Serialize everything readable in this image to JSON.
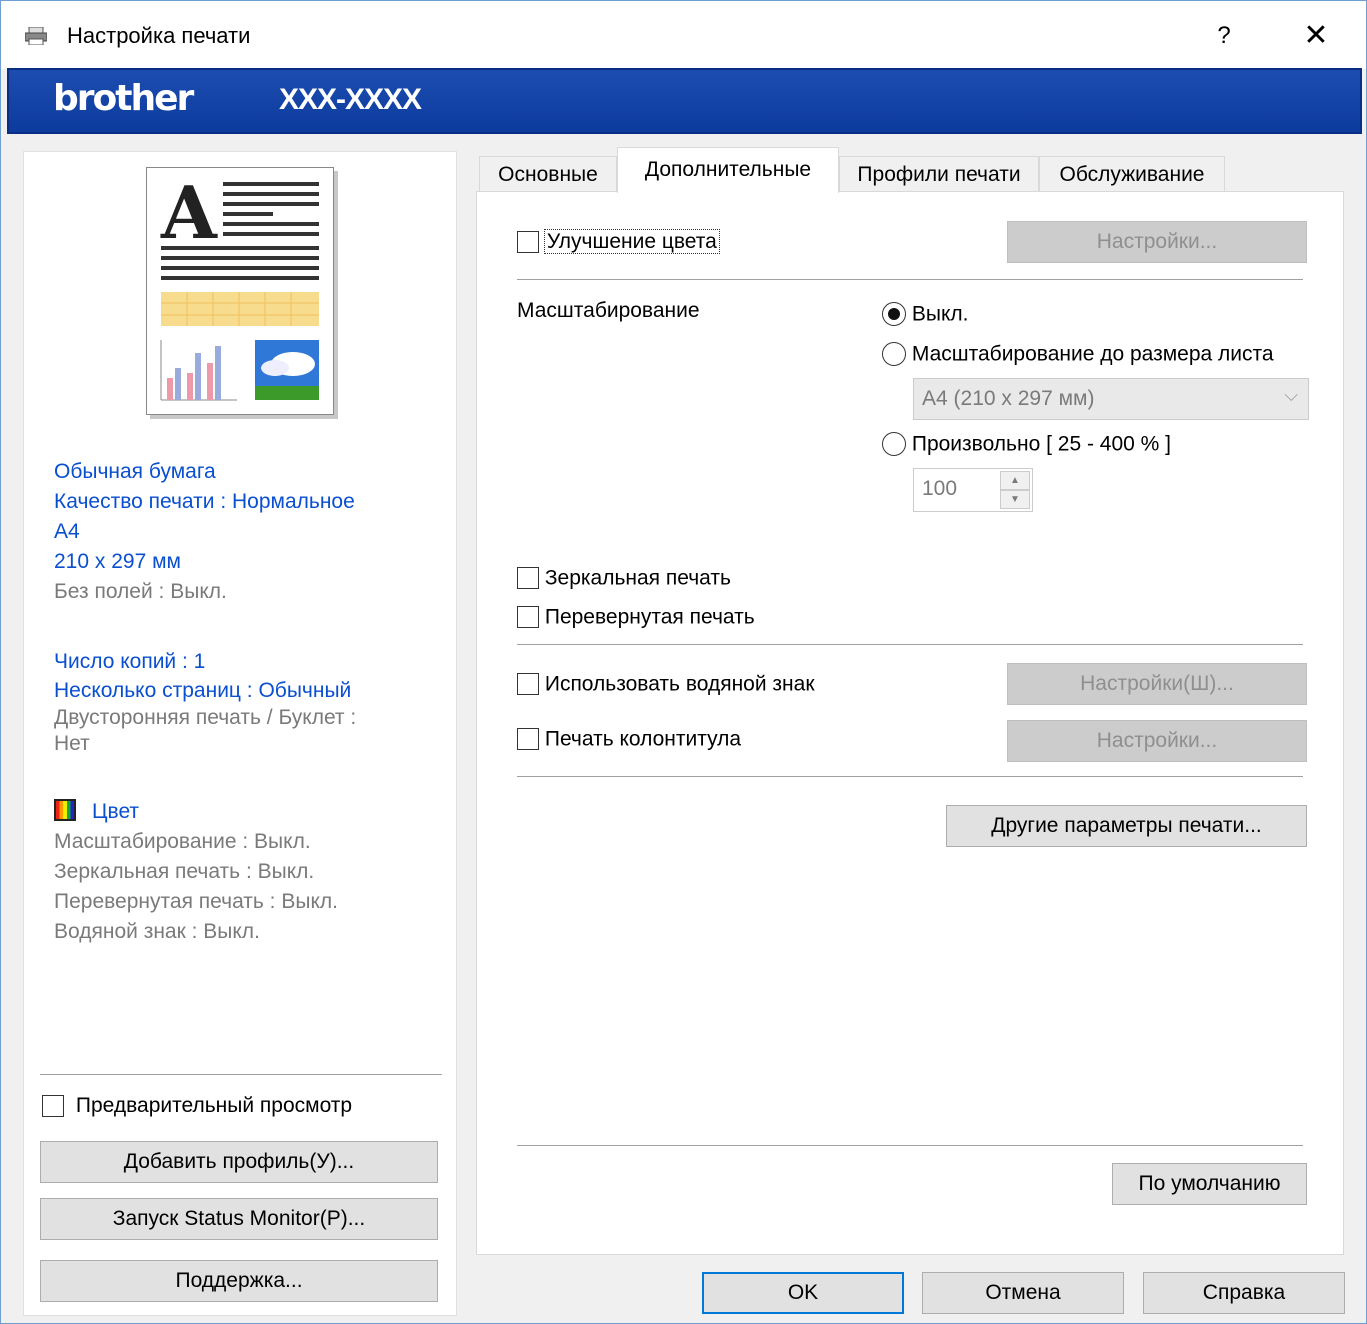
{
  "window": {
    "title": "Настройка печати",
    "help_label": "?",
    "close_label": "✕"
  },
  "banner": {
    "brand": "brother",
    "model": "XXX-XXXX"
  },
  "left": {
    "paper_type": "Обычная бумага",
    "quality": "Качество печати : Нормальное",
    "paper_size": "A4",
    "dimensions": "210 x 297 мм",
    "borderless": "Без полей : Выкл.",
    "copies": "Число копий : 1",
    "multipage": "Несколько страниц : Обычный",
    "duplex_line1": "Двусторонняя печать / Буклет :",
    "duplex_line2": "Нет",
    "color": "Цвет",
    "scaling": "Масштабирование : Выкл.",
    "mirror": "Зеркальная печать : Выкл.",
    "reverse": "Перевернутая печать : Выкл.",
    "watermark": "Водяной знак : Выкл.",
    "preview_label": "Предварительный просмотр",
    "add_profile": "Добавить профиль(У)...",
    "status_monitor": "Запуск Status Monitor(P)...",
    "support": "Поддержка..."
  },
  "tabs": [
    {
      "label": "Основные"
    },
    {
      "label": "Дополнительные"
    },
    {
      "label": "Профили печати"
    },
    {
      "label": "Обслуживание"
    }
  ],
  "advanced": {
    "color_enhance": "Улучшение цвета",
    "color_settings": "Настройки...",
    "scaling_label": "Масштабирование",
    "scale_off": "Выкл.",
    "scale_fit": "Масштабирование до размера листа",
    "fit_paper_value": "A4 (210 x 297 мм)",
    "scale_custom": "Произвольно [ 25 - 400 % ]",
    "custom_value": "100",
    "mirror_print": "Зеркальная печать",
    "reverse_print": "Перевернутая печать",
    "use_watermark": "Использовать водяной знак",
    "watermark_settings": "Настройки(Ш)...",
    "header_footer": "Печать колонтитула",
    "header_settings": "Настройки...",
    "other_options": "Другие параметры печати...",
    "default_button": "По умолчанию"
  },
  "footer": {
    "ok": "OK",
    "cancel": "Отмена",
    "help": "Справка"
  },
  "colors": {
    "banner": "#1d4db0",
    "info_blue": "#0a4fd0",
    "focus": "#0078d7"
  }
}
